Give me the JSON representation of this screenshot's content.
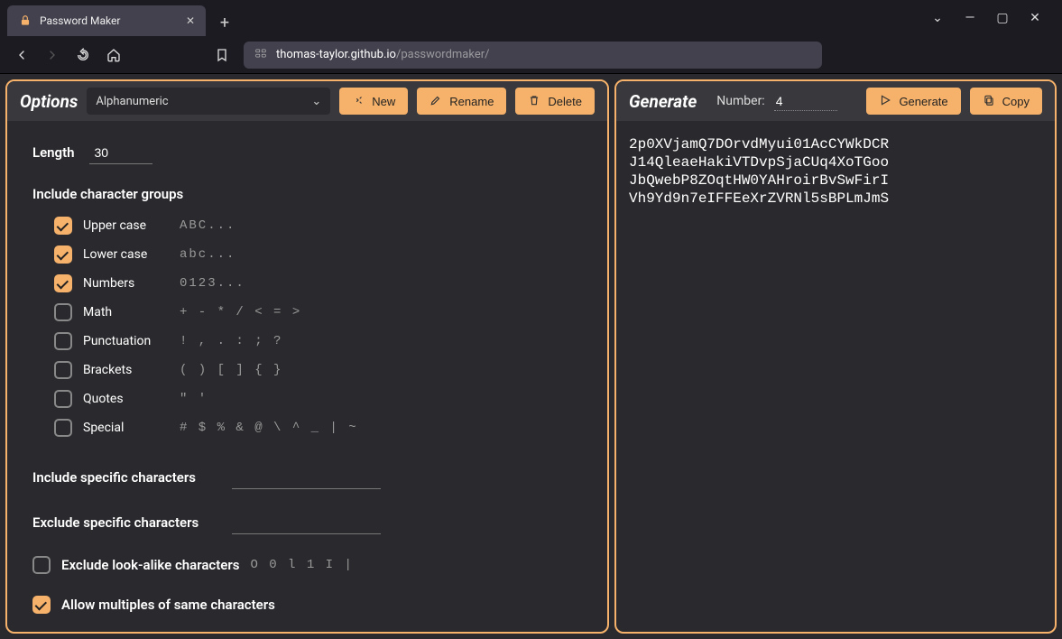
{
  "browser": {
    "tab": {
      "title": "Password Maker"
    },
    "url": {
      "host": "thomas-taylor.github.io",
      "path": "/passwordmaker/"
    }
  },
  "options": {
    "title": "Options",
    "preset": "Alphanumeric",
    "buttons": {
      "new": "New",
      "rename": "Rename",
      "delete": "Delete"
    },
    "length": {
      "label": "Length",
      "value": "30"
    },
    "groupsLabel": "Include character groups",
    "groups": [
      {
        "label": "Upper case",
        "checked": true,
        "samples": "ABC..."
      },
      {
        "label": "Lower case",
        "checked": true,
        "samples": "abc..."
      },
      {
        "label": "Numbers",
        "checked": true,
        "samples": "0123..."
      },
      {
        "label": "Math",
        "checked": false,
        "samples": "+ - * / < = >"
      },
      {
        "label": "Punctuation",
        "checked": false,
        "samples": "! , . : ; ?"
      },
      {
        "label": "Brackets",
        "checked": false,
        "samples": "( ) [ ] { }"
      },
      {
        "label": "Quotes",
        "checked": false,
        "samples": "\" '"
      },
      {
        "label": "Special",
        "checked": false,
        "samples": "# $ % & @ \\ ^ _ | ~"
      }
    ],
    "includeSpecific": {
      "label": "Include specific characters",
      "value": ""
    },
    "excludeSpecific": {
      "label": "Exclude specific characters",
      "value": ""
    },
    "excludeLookalike": {
      "label": "Exclude look-alike characters",
      "checked": false,
      "samples": "O 0 l 1 I |"
    },
    "allowMultiples": {
      "label": "Allow multiples of same characters",
      "checked": true
    }
  },
  "generate": {
    "title": "Generate",
    "numberLabel": "Number:",
    "numberValue": "4",
    "buttons": {
      "generate": "Generate",
      "copy": "Copy"
    },
    "output": [
      "2p0XVjamQ7DOrvdMyui01AcCYWkDCR",
      "J14QleaeHakiVTDvpSjaCUq4XoTGoo",
      "JbQwebP8ZOqtHW0YAHroirBvSwFirI",
      "Vh9Yd9n7eIFFEeXrZVRNl5sBPLmJmS"
    ]
  }
}
